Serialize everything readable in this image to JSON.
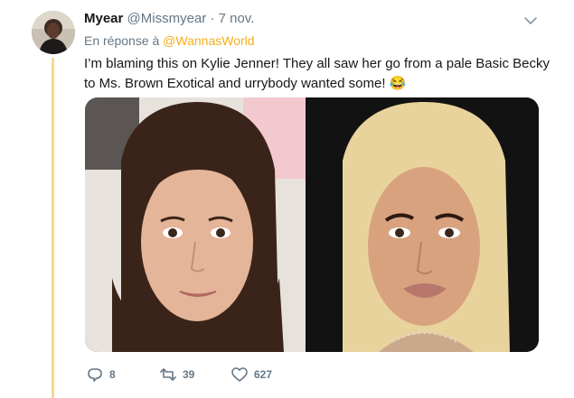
{
  "tweet": {
    "author_name": "Myear",
    "author_handle": "@Missmyear",
    "separator": "·",
    "date": "7 nov.",
    "reply_prefix": "En réponse à",
    "reply_mention": "@WannasWorld",
    "text": "I’m blaming this on Kylie Jenner! They all saw her go from a pale Basic Becky to Ms. Brown Exotical and urrybody wanted some! 😂",
    "media_description_icons": [
      "image-left-icon",
      "image-right-icon"
    ]
  },
  "actions": {
    "reply_count": "8",
    "retweet_count": "39",
    "like_count": "627"
  },
  "colors": {
    "thread_line": "#f7d88c",
    "mention": "#f4ad1c",
    "secondary_text": "#657786"
  }
}
